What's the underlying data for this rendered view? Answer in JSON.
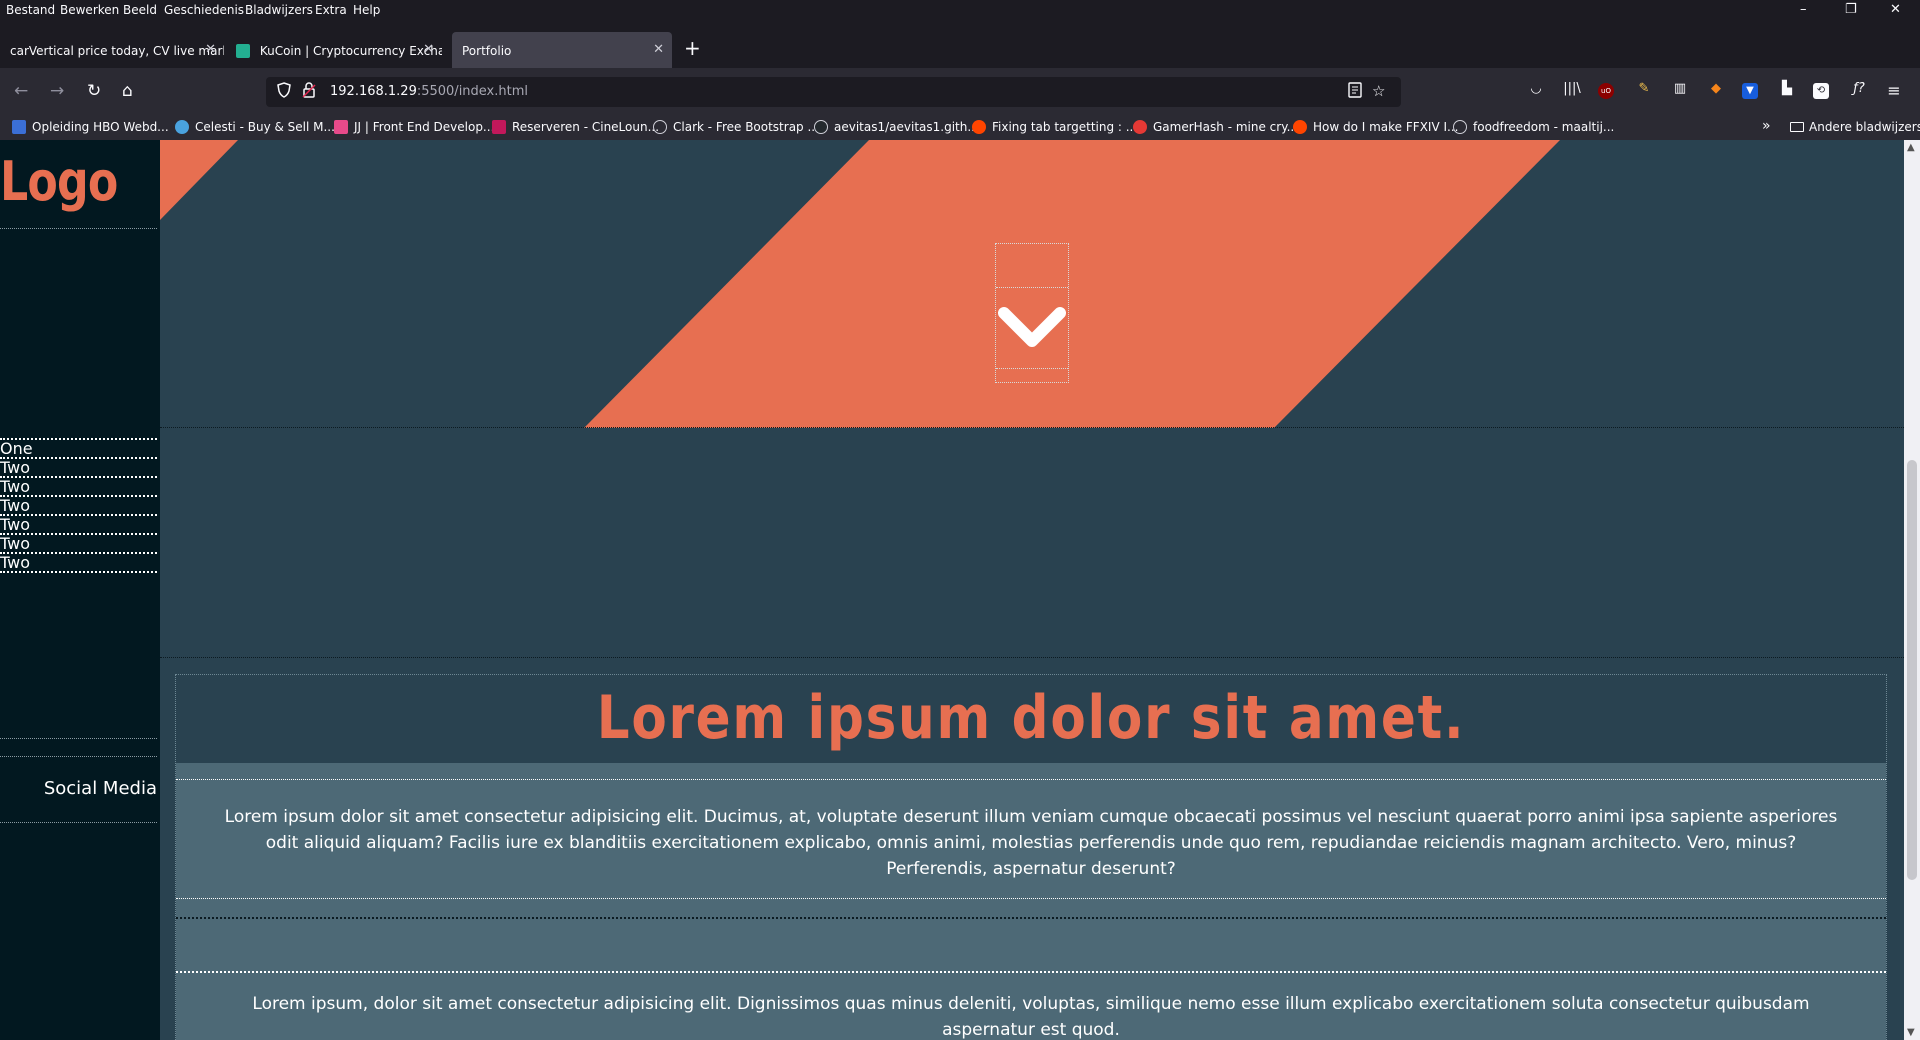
{
  "menubar": {
    "items": [
      "Bestand",
      "Bewerken",
      "Beeld",
      "Geschiedenis",
      "Bladwijzers",
      "Extra",
      "Help"
    ],
    "minimize": "–",
    "restore": "❐",
    "close": "✕"
  },
  "tabs": [
    {
      "title": "carVertical price today, CV live mark",
      "favicon_color": "#1c1b22"
    },
    {
      "title": "KuCoin | Cryptocurrency Exchan",
      "favicon_color": "#23af91"
    },
    {
      "title": "Portfolio",
      "favicon_color": "#42414d",
      "active": true
    }
  ],
  "tab_close": "✕",
  "new_tab": "+",
  "nav": {
    "back": "←",
    "forward": "→",
    "reload": "↻",
    "home": "⌂",
    "url_host": "192.168.1.29",
    "url_path": ":5500/index.html"
  },
  "toolbar_icons": [
    "pocket-icon",
    "library-icon",
    "ublock-icon",
    "extension-badge-icon",
    "barcode-icon",
    "metamask-icon",
    "bitwarden-icon",
    "reader-icon",
    "sync-icon",
    "formula-icon",
    "menu-icon"
  ],
  "bookmarks": [
    {
      "label": "Opleiding HBO Webd...",
      "color": "#3b6fd6"
    },
    {
      "label": "Celesti - Buy & Sell M...",
      "color": "#4aa3df"
    },
    {
      "label": "JJ | Front End Develop...",
      "color": "#e84a8a"
    },
    {
      "label": "Reserveren - CineLoun...",
      "color": "#c2185b"
    },
    {
      "label": "Clark - Free Bootstrap ...",
      "color": "#8f8f9d"
    },
    {
      "label": "aevitas1/aevitas1.gith...",
      "color": "#24292e"
    },
    {
      "label": "Fixing tab targetting : ...",
      "color": "#ff4500"
    },
    {
      "label": "GamerHash - mine cry...",
      "color": "#e53935"
    },
    {
      "label": "How do I make FFXIV I...",
      "color": "#ff4500"
    },
    {
      "label": "foodfreedom - maaltij...",
      "color": "#8f8f9d"
    }
  ],
  "bookmarks_more": "»",
  "other_bookmarks": "Andere bladwijzers",
  "page": {
    "logo": "Logo",
    "nav_links": [
      "One",
      "Two",
      "Two",
      "Two",
      "Two",
      "Two",
      "Two"
    ],
    "social": "Social Media",
    "headline": "Lorem ipsum dolor sit amet.",
    "paragraph_1": "Lorem ipsum dolor sit amet consectetur adipisicing elit. Ducimus, at, voluptate deserunt illum veniam cumque obcaecati possimus vel nesciunt quaerat porro animi ipsa sapiente asperiores odit aliquid aliquam? Facilis iure ex blanditiis exercitationem explicabo, omnis animi, molestias perferendis unde quo rem, repudiandae reiciendis magnam architecto. Vero, minus? Perferendis, aspernatur deserunt?",
    "paragraph_2": "Lorem ipsum, dolor sit amet consectetur adipisicing elit. Dignissimos quas minus deleniti, voluptas, similique nemo esse illum explicabo exercitationem soluta consectetur quibusdam aspernatur est quod."
  },
  "colors": {
    "accent": "#e76f51",
    "page_bg": "#294250",
    "sidebar_bg": "#021820",
    "panel_bg": "#4d6976"
  }
}
